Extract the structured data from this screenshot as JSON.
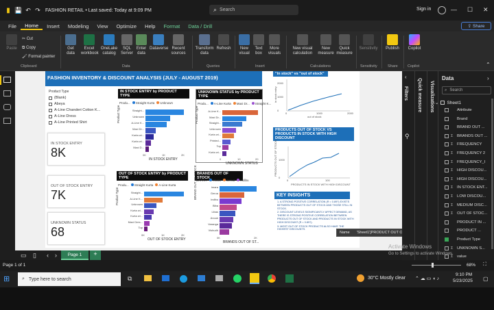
{
  "titlebar": {
    "doc_title": "FASHION RETAIL • Last saved: Today at 9:09 PM",
    "search": "Search",
    "signin": "Sign in"
  },
  "menu": [
    "File",
    "Home",
    "Insert",
    "Modeling",
    "View",
    "Optimize",
    "Help",
    "Format",
    "Data / Drill"
  ],
  "share": "Share",
  "ribbon": {
    "clipboard": {
      "paste": "Paste",
      "cut": "Cut",
      "copy": "Copy",
      "format_painter": "Format painter",
      "group": "Clipboard"
    },
    "data": {
      "get": "Get data",
      "excel": "Excel workbook",
      "onelake": "OneLake catalog",
      "sql": "SQL Server",
      "enter": "Enter data",
      "dataverse": "Dataverse",
      "recent": "Recent sources",
      "group": "Data"
    },
    "queries": {
      "transform": "Transform data",
      "refresh": "Refresh",
      "group": "Queries"
    },
    "insert": {
      "newvisual": "New visual",
      "textbox": "Text box",
      "more": "More visuals",
      "group": "Insert"
    },
    "calc": {
      "newcalc": "New visual calculation",
      "newmeasure": "New measure",
      "quick": "Quick measure",
      "group": "Calculations"
    },
    "sens": {
      "label": "Sensitivity",
      "group": "Sensitivity"
    },
    "share": {
      "publish": "Publish",
      "group": "Share"
    },
    "copilot": {
      "label": "Copilot",
      "group": "Copilot"
    }
  },
  "report": {
    "title": "FASHION INVENTORY & DISCOUNT ANALYSIS (JULY - AUGUST 2019)",
    "slicer": {
      "header": "Product Type",
      "items": [
        "(Blank)",
        "Abeya",
        "A-Line Chanderi Cotton K...",
        "A-Line Dress",
        "A-Line Printed Shirt"
      ]
    },
    "cards": [
      {
        "label": "IN STOCK ENTRY",
        "value": "8K"
      },
      {
        "label": "OUT OF STOCK ENTRY",
        "value": "7K"
      },
      {
        "label": "UNKNOWN STATUS",
        "value": "68"
      }
    ],
    "instock_chart": {
      "title": "IN STOCK ENTRY by PRODUCT TYPE",
      "legend": [
        "Produ...",
        "Straight Kurta",
        "Unknown"
      ],
      "ylabel": "Product Type",
      "xlabel": "IN STOCK ENTRY",
      "cats": [
        "Straight...",
        "Unknown",
        "A-Line K...",
        "Maxi Dr...",
        "Kurta wi...",
        "Kurta wi...",
        "Maxi D..."
      ],
      "values": [
        2.1,
        1.35,
        1.15,
        0.55,
        0.45,
        0.3,
        0.2
      ],
      "xticks": [
        "0K",
        "1K",
        "2K"
      ],
      "colors": [
        "#1f77d4",
        "#1f77d4",
        "#1f77d4",
        "#1f77d4",
        "#1f1f8f",
        "#1f1f8f",
        "#1f1f8f"
      ]
    },
    "unknown_chart": {
      "title": "UNKNOWN STATUS by PRODUCT TYPE",
      "legend": [
        "Produ...",
        "A-Line Kurta",
        "Maxi Dr...",
        "Straight K..."
      ],
      "ylabel": "Product Type",
      "xlabel": "UNKNOWN STATUS",
      "cats": [
        "A-Line K...",
        "Maxi Dr...",
        "Straight...",
        "Unknown",
        "Kurta wi...",
        "Printed...",
        "Top",
        "Kurta wi..."
      ],
      "values": [
        18,
        12,
        10,
        7,
        6,
        4,
        3,
        2
      ],
      "xticks": [
        "0",
        "10",
        "20"
      ]
    },
    "scatter_top": {
      "title": "\"in stock\" vs \"out of stock\"",
      "xlabel": "out of stock",
      "ylabel": "in stock entry",
      "xticks": [
        "0",
        "1000",
        "2000"
      ],
      "yticks": [
        "0",
        "1000",
        "2000"
      ]
    },
    "line_chart": {
      "title": "PRODUCTS OUT OF STOCK VS PRODUCTS IN STOCK WITH HIGH DISCOUNT",
      "xlabel": "PRODUCTS IN STOCK WITH HIGH DISCOUNT",
      "ylabel": "PRODUCTS OUT OF STOCK",
      "xticks": [
        "0",
        "100"
      ],
      "yticks": [
        "0",
        "1000"
      ]
    },
    "outstock_chart": {
      "title": "OUT OF STOCK ENTRY by PRODUCT TYPE",
      "legend": [
        "Produ...",
        "Straight Kurta",
        "A-Line Kurta"
      ],
      "ylabel": "Product Type",
      "xlabel": "OUT OF STOCK ENTRY",
      "cats": [
        "Straight...",
        "A-Line K...",
        "Unknown",
        "Kurta wi...",
        "Kurta wi...",
        "Maxi Dres...",
        "Top"
      ],
      "values": [
        1.9,
        0.9,
        0.6,
        0.45,
        0.35,
        0.25,
        0.15
      ],
      "xticks": [
        "0K",
        "1K",
        "2K"
      ]
    },
    "brands_chart": {
      "title": "BRANDS OUT OF STOCK",
      "legend": [
        "BRAN...",
        "Imara",
        "Gerua",
        "Indibu"
      ],
      "ylabel": "BRAND OUT OF STOCK",
      "xlabel": "BRANDS OUT OF ST...",
      "cats": [
        "Imara",
        "Gerua",
        "Indibu",
        "Biba",
        "Libas",
        "Anouk",
        "Varanga",
        "Vishudh"
      ],
      "values": [
        2.4,
        1.6,
        1.4,
        1.1,
        1.0,
        0.9,
        0.8,
        0.6
      ],
      "xticks": [
        "0K",
        "2K"
      ]
    },
    "insights": {
      "title": "KEY INSIGHTS",
      "lines": [
        "1. A STRONG POSITIVE CORRELATION (R = 0.89?) EXISTS BETWEEN PRODUCTS OUT OF STOCK AND THOSE STILL IN STOCK.",
        "2. DISCOUNT LEVELS SIGNIFICANTLY AFFECT DEMAND, AS THERE IS STRONG POSITIVE CORRELATION BETWEEN PRODUCTS OUT OF STOCK AND PRODUCTS IN STOCK WITH HIGH DISCOUNT (R = 0.89?).",
        "3. MOST OUT OF STOCK PRODUCTS ALSO HAVE THE HIGHEST DISCOUNTS."
      ]
    }
  },
  "tooltip": {
    "label": "Name",
    "value": "'Sheet1'[PRODUCT OUT OF STOCK]"
  },
  "panes": {
    "filters": "Filters",
    "quick_measure": "Quick measure",
    "visualizations": "Visualizations",
    "data": "Data",
    "search": "Search",
    "table": "Sheet1"
  },
  "fields": [
    {
      "name": "Attribute",
      "sigma": false,
      "checked": false
    },
    {
      "name": "Brand",
      "sigma": false,
      "checked": false
    },
    {
      "name": "BRAND OUT ...",
      "sigma": false,
      "checked": false
    },
    {
      "name": "BRANDS OUT ...",
      "sigma": true,
      "checked": false
    },
    {
      "name": "FREQUENCY",
      "sigma": true,
      "checked": false
    },
    {
      "name": "FREQUENCY 2",
      "sigma": true,
      "checked": false
    },
    {
      "name": "FREQUENCY_I",
      "sigma": true,
      "checked": false
    },
    {
      "name": "HIGH DISCOU...",
      "sigma": true,
      "checked": false
    },
    {
      "name": "HIGH DISCOU...",
      "sigma": true,
      "checked": false
    },
    {
      "name": "IN STOCK ENT...",
      "sigma": true,
      "checked": false
    },
    {
      "name": "LOW DISCOU...",
      "sigma": true,
      "checked": false
    },
    {
      "name": "MEDIUM DISC...",
      "sigma": true,
      "checked": false
    },
    {
      "name": "OUT OF STOC...",
      "sigma": true,
      "checked": false
    },
    {
      "name": "PRODUCT IN ...",
      "sigma": false,
      "checked": false
    },
    {
      "name": "PRODUCT ...",
      "sigma": false,
      "checked": false
    },
    {
      "name": "Product Type",
      "sigma": false,
      "checked": true
    },
    {
      "name": "UNKNOWN S...",
      "sigma": true,
      "checked": false
    },
    {
      "name": "value",
      "sigma": true,
      "checked": false
    }
  ],
  "status": {
    "page": "Page 1 of 1",
    "tab": "Page 1",
    "zoom": "68%",
    "activate1": "Activate Windows",
    "activate2": "Go to Settings to activate Windows."
  },
  "taskbar": {
    "search": "Type here to search",
    "weather": "30°C  Mostly clear",
    "time": "9:10 PM",
    "date": "5/23/2025"
  }
}
